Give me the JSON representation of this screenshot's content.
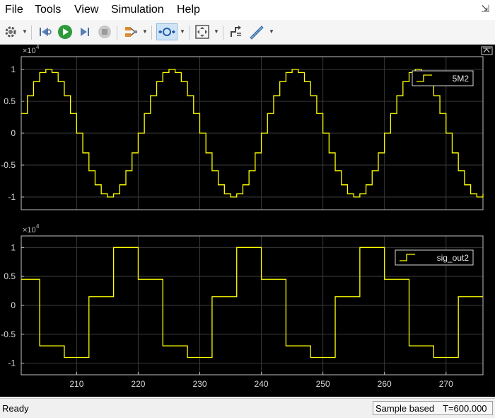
{
  "menu": [
    "File",
    "Tools",
    "View",
    "Simulation",
    "Help"
  ],
  "status": {
    "ready": "Ready",
    "sample_mode": "Sample based",
    "time": "T=600.000"
  },
  "colors": {
    "background": "#000000",
    "trace": "#ffff00",
    "grid": "#3a3a3a",
    "axis": "#bfbfbf"
  },
  "toolbar_icons": [
    "settings-icon",
    "step-back-icon",
    "run-icon",
    "step-forward-icon",
    "stop-icon",
    "signal-selector-icon",
    "zoom-in-icon",
    "fit-to-view-icon",
    "triggers-icon",
    "measurements-icon",
    "restore-layout-icon"
  ],
  "chart_data": [
    {
      "type": "line",
      "step": true,
      "x_exponent_label": "×10",
      "y_exponent": "4",
      "legend": "5M2",
      "legend_position": "top-right",
      "grid": true,
      "xlim": [
        201,
        276
      ],
      "ylim": [
        -1.2,
        1.2
      ],
      "yticks": [
        -1,
        -0.5,
        0,
        0.5,
        1
      ],
      "ytick_labels": [
        "-1",
        "-0.5",
        "0",
        "0.5",
        "1"
      ],
      "x": [
        201,
        202,
        203,
        204,
        205,
        206,
        207,
        208,
        209,
        210,
        211,
        212,
        213,
        214,
        215,
        216,
        217,
        218,
        219,
        220,
        221,
        222,
        223,
        224,
        225,
        226,
        227,
        228,
        229,
        230,
        231,
        232,
        233,
        234,
        235,
        236,
        237,
        238,
        239,
        240,
        241,
        242,
        243,
        244,
        245,
        246,
        247,
        248,
        249,
        250,
        251,
        252,
        253,
        254,
        255,
        256,
        257,
        258,
        259,
        260,
        261,
        262,
        263,
        264,
        265,
        266,
        267,
        268,
        269,
        270,
        271,
        272,
        273,
        274,
        275,
        276
      ],
      "y": [
        0.309,
        0.588,
        0.809,
        0.951,
        1.0,
        0.951,
        0.809,
        0.588,
        0.309,
        0.0,
        -0.309,
        -0.588,
        -0.809,
        -0.951,
        -1.0,
        -0.951,
        -0.809,
        -0.588,
        -0.309,
        0.0,
        0.309,
        0.588,
        0.809,
        0.951,
        1.0,
        0.951,
        0.809,
        0.588,
        0.309,
        0.0,
        -0.309,
        -0.588,
        -0.809,
        -0.951,
        -1.0,
        -0.951,
        -0.809,
        -0.588,
        -0.309,
        0.0,
        0.309,
        0.588,
        0.809,
        0.951,
        1.0,
        0.951,
        0.809,
        0.588,
        0.309,
        0.0,
        -0.309,
        -0.588,
        -0.809,
        -0.951,
        -1.0,
        -0.951,
        -0.809,
        -0.588,
        -0.309,
        0.0,
        0.309,
        0.588,
        0.809,
        0.951,
        1.0,
        0.951,
        0.809,
        0.588,
        0.309,
        0.0,
        -0.309,
        -0.588,
        -0.809,
        -0.951,
        -1.0,
        -0.951
      ]
    },
    {
      "type": "line",
      "step": true,
      "x_exponent_label": "×10",
      "y_exponent": "4",
      "legend": "sig_out2",
      "legend_position": "top-right",
      "grid": true,
      "xlim": [
        201,
        276
      ],
      "ylim": [
        -1.2,
        1.2
      ],
      "yticks": [
        -1,
        -0.5,
        0,
        0.5,
        1
      ],
      "ytick_labels": [
        "-1",
        "-0.5",
        "0",
        "0.5",
        "1"
      ],
      "xticks": [
        210,
        220,
        230,
        240,
        250,
        260,
        270
      ],
      "xtick_labels": [
        "210",
        "220",
        "230",
        "240",
        "250",
        "260",
        "270"
      ],
      "x": [
        201,
        204,
        208,
        212,
        216,
        220,
        224,
        228,
        232,
        236,
        240,
        244,
        248,
        252,
        256,
        260,
        264,
        268,
        272,
        276
      ],
      "y": [
        0.45,
        -0.7,
        -0.9,
        0.15,
        1.0,
        0.45,
        -0.7,
        -0.9,
        0.15,
        1.0,
        0.45,
        -0.7,
        -0.9,
        0.15,
        1.0,
        0.45,
        -0.7,
        -0.9,
        0.15,
        0.15
      ]
    }
  ]
}
